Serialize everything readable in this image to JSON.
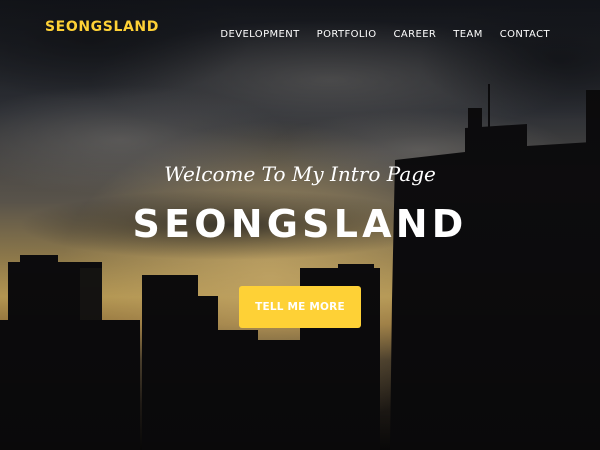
{
  "colors": {
    "brand": "#fed136",
    "button": "#fed136",
    "text": "#ffffff"
  },
  "navbar": {
    "brand": "SEONGSLAND",
    "links": [
      "DEVELOPMENT",
      "PORTFOLIO",
      "CAREER",
      "TEAM",
      "CONTACT"
    ]
  },
  "hero": {
    "lead": "Welcome To My Intro Page",
    "heading": "SEONGSLAND",
    "button_label": "TELL ME MORE"
  }
}
